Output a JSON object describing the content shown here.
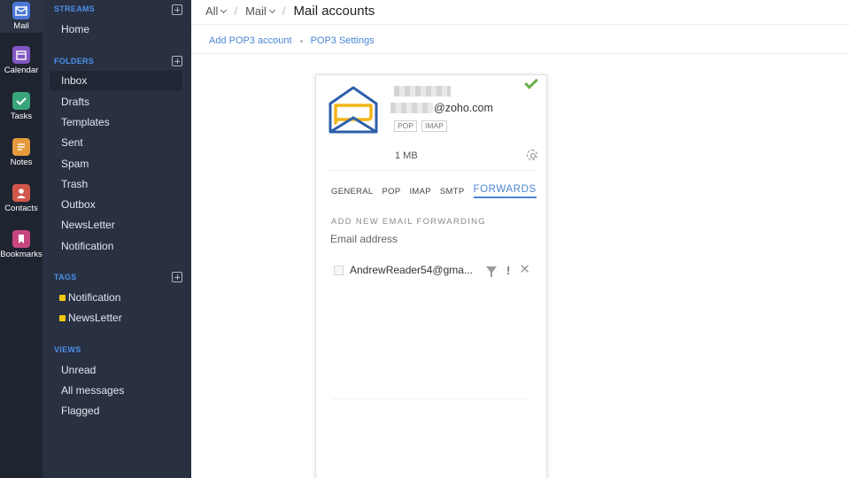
{
  "rail": {
    "items": [
      {
        "id": "mail",
        "label": "Mail",
        "icon": "mail-icon",
        "color": "#4a78d6"
      },
      {
        "id": "calendar",
        "label": "Calendar",
        "icon": "calendar-icon",
        "color": "#8257c3"
      },
      {
        "id": "tasks",
        "label": "Tasks",
        "icon": "tasks-icon",
        "color": "#3aa57a"
      },
      {
        "id": "notes",
        "label": "Notes",
        "icon": "notes-icon",
        "color": "#e49a3d"
      },
      {
        "id": "contacts",
        "label": "Contacts",
        "icon": "contacts-icon",
        "color": "#d0574a"
      },
      {
        "id": "bookmarks",
        "label": "Bookmarks",
        "icon": "bookmarks-icon",
        "color": "#c8467f"
      }
    ]
  },
  "pane": {
    "streams": {
      "title": "STREAMS",
      "items": [
        "Home"
      ]
    },
    "folders": {
      "title": "FOLDERS",
      "items": [
        "Inbox",
        "Drafts",
        "Templates",
        "Sent",
        "Spam",
        "Trash",
        "Outbox",
        "NewsLetter",
        "Notification"
      ],
      "selected": "Inbox"
    },
    "tags": {
      "title": "TAGS",
      "items": [
        "Notification",
        "NewsLetter"
      ],
      "color": "#f2c80f"
    },
    "views": {
      "title": "VIEWS",
      "items": [
        "Unread",
        "All messages",
        "Flagged"
      ]
    }
  },
  "header": {
    "crumbs": [
      "All",
      "Mail"
    ],
    "title": "Mail accounts",
    "subnav": [
      "Add POP3 account",
      "POP3 Settings"
    ]
  },
  "account": {
    "email_domain": "@zoho.com",
    "badges": [
      "POP",
      "IMAP"
    ],
    "size": "1 MB",
    "status": "verified-check-icon",
    "tabs": [
      "GENERAL",
      "POP",
      "IMAP",
      "SMTP",
      "FORWARDS"
    ],
    "active_tab": "FORWARDS",
    "forwarding": {
      "heading": "ADD NEW EMAIL FORWARDING",
      "placeholder": "Email address",
      "entries": [
        {
          "email": "AndrewReader54@gma..."
        }
      ]
    }
  },
  "colors": {
    "accent": "#4a86d4",
    "rail_bg": "#1e2430",
    "pane_bg": "#283042",
    "section_head": "#4d8fe6",
    "success": "#6ab04c"
  }
}
